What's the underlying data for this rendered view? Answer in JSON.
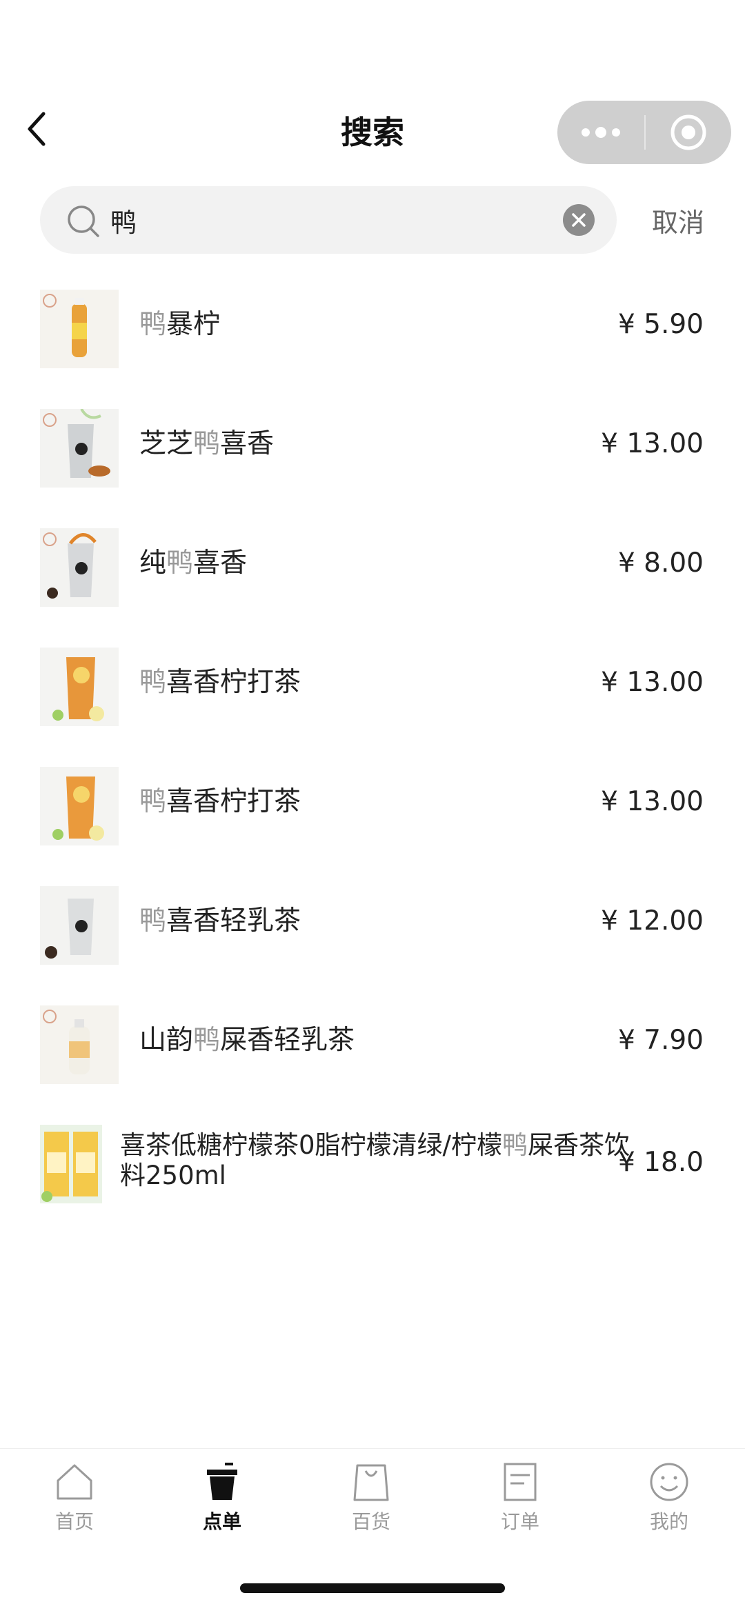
{
  "header": {
    "title": "搜索"
  },
  "search": {
    "query": "鸭",
    "cancel_label": "取消"
  },
  "results": [
    {
      "pre": "",
      "hl": "鸭",
      "post": "暴柠",
      "price": "¥ 5.90"
    },
    {
      "pre": "芝芝",
      "hl": "鸭",
      "post": "喜香",
      "price": "¥ 13.00"
    },
    {
      "pre": "纯",
      "hl": "鸭",
      "post": "喜香",
      "price": "¥ 8.00"
    },
    {
      "pre": "",
      "hl": "鸭",
      "post": "喜香柠打茶",
      "price": "¥ 13.00"
    },
    {
      "pre": "",
      "hl": "鸭",
      "post": "喜香柠打茶",
      "price": "¥ 13.00"
    },
    {
      "pre": "",
      "hl": "鸭",
      "post": "喜香轻乳茶",
      "price": "¥ 12.00"
    },
    {
      "pre": "山韵",
      "hl": "鸭",
      "post": "屎香轻乳茶",
      "price": "¥ 7.90"
    },
    {
      "pre": "喜茶低糖柠檬茶0脂柠檬清绿/柠檬",
      "hl": "鸭",
      "post": "屎香茶饮料250ml",
      "price": "¥ 18.0"
    }
  ],
  "tabbar": {
    "items": [
      {
        "label": "首页",
        "icon": "home-icon"
      },
      {
        "label": "点单",
        "icon": "cup-icon"
      },
      {
        "label": "百货",
        "icon": "shopping-bag-icon"
      },
      {
        "label": "订单",
        "icon": "order-list-icon"
      },
      {
        "label": "我的",
        "icon": "smiley-icon"
      }
    ],
    "active_index": 1
  },
  "colors": {
    "highlight": "#999999",
    "text": "#222222",
    "tab_inactive": "#9a9a9a",
    "capsule": "#cfcfcf"
  }
}
